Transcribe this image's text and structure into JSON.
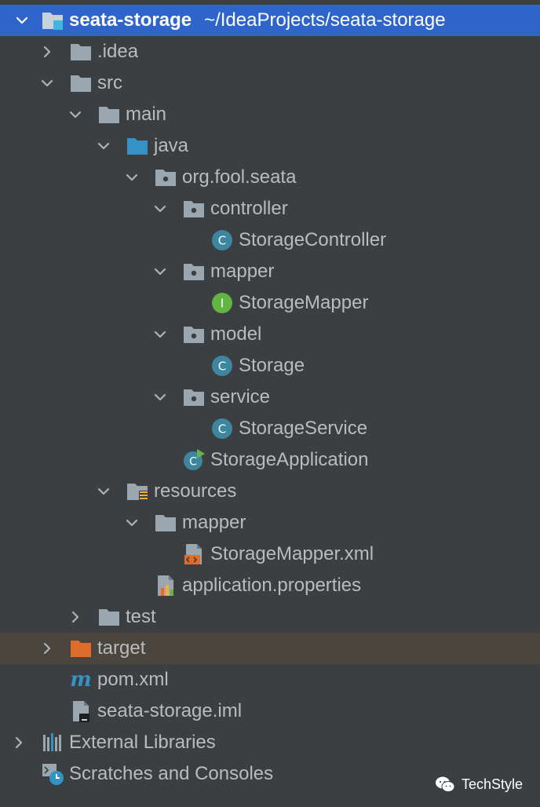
{
  "project": {
    "name": "seata-storage",
    "path": "~/IdeaProjects/seata-storage"
  },
  "tree": {
    "idea": ".idea",
    "src": "src",
    "main": "main",
    "java": "java",
    "package": "org.fool.seata",
    "controller": "controller",
    "storage_controller": "StorageController",
    "mapper_pkg": "mapper",
    "storage_mapper": "StorageMapper",
    "model": "model",
    "storage": "Storage",
    "service": "service",
    "storage_service": "StorageService",
    "storage_application": "StorageApplication",
    "resources": "resources",
    "res_mapper": "mapper",
    "storage_mapper_xml": "StorageMapper.xml",
    "app_properties": "application.properties",
    "test": "test",
    "target": "target",
    "pom": "pom.xml",
    "iml": "seata-storage.iml",
    "external_libraries": "External Libraries",
    "scratches": "Scratches and Consoles"
  },
  "watermark": {
    "text": "TechStyle"
  },
  "colors": {
    "selection": "#2f65ca",
    "background": "#3c3f41",
    "excluded": "#4a453d",
    "folder": "#9aa7b0",
    "source_folder": "#3592c4",
    "excluded_folder": "#e06c2c",
    "class": "#3e86a0",
    "interface": "#62b543"
  }
}
